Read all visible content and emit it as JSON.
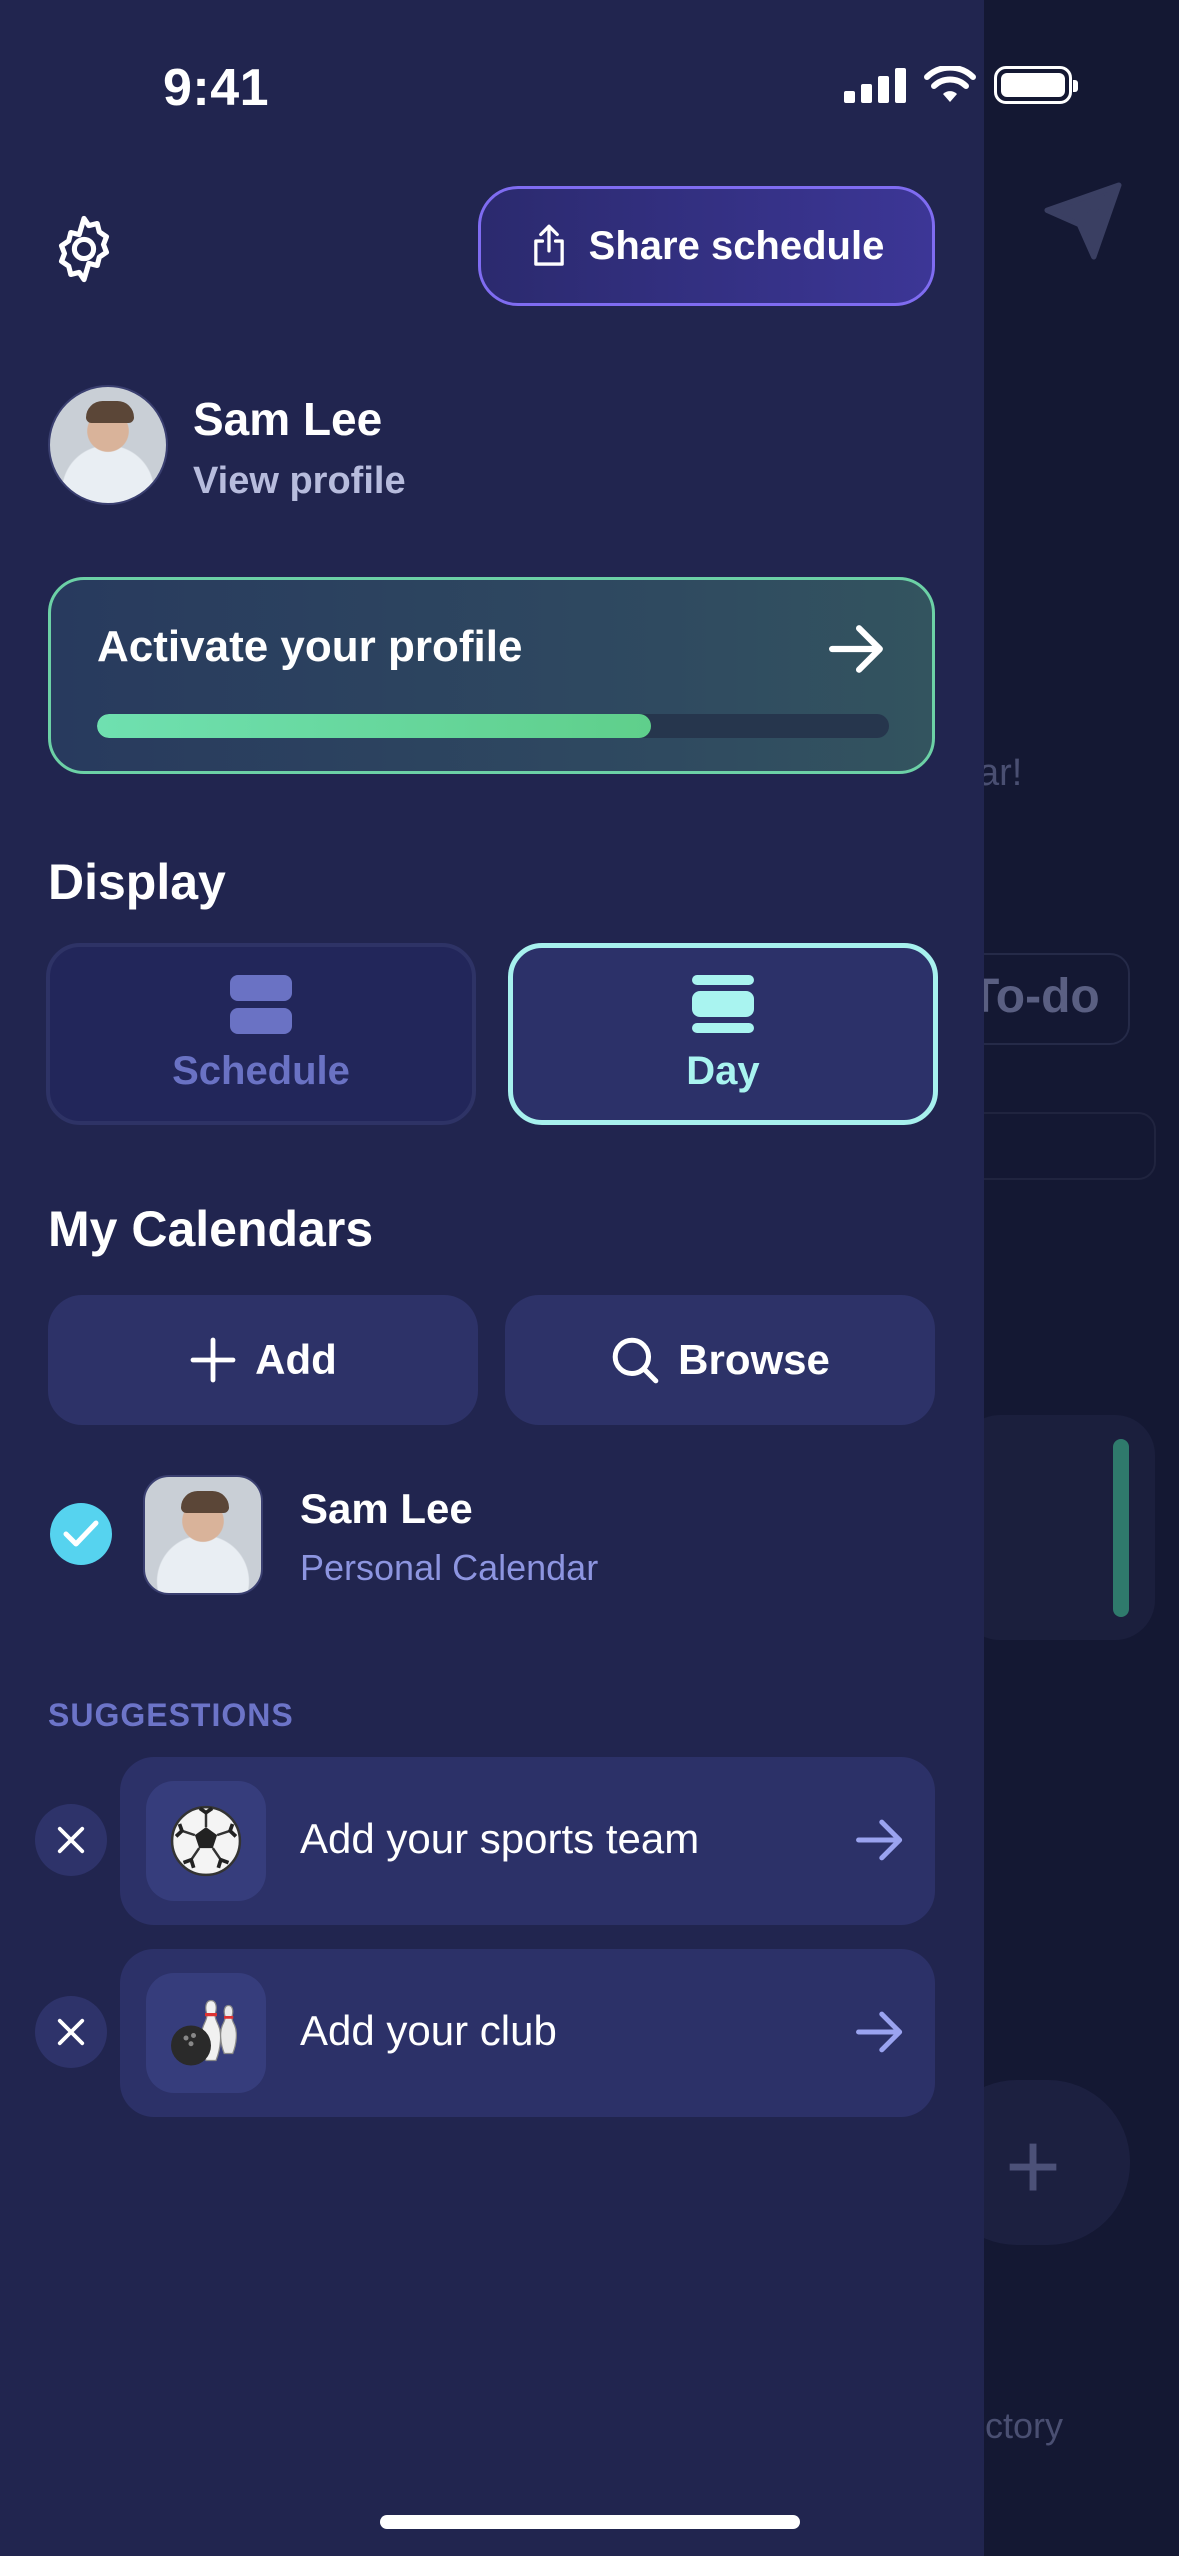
{
  "status_bar": {
    "time": "9:41"
  },
  "header": {
    "share_label": "Share schedule"
  },
  "profile": {
    "name": "Sam Lee",
    "link": "View profile"
  },
  "activate": {
    "title": "Activate your profile",
    "progress": 0.7
  },
  "display": {
    "title": "Display",
    "options": [
      {
        "label": "Schedule",
        "selected": false
      },
      {
        "label": "Day",
        "selected": true
      }
    ]
  },
  "calendars": {
    "title": "My Calendars",
    "add_label": "Add",
    "browse_label": "Browse",
    "items": [
      {
        "name": "Sam Lee",
        "subtitle": "Personal Calendar",
        "checked": true
      }
    ]
  },
  "suggestions": {
    "title": "SUGGESTIONS",
    "items": [
      {
        "label": "Add your sports team",
        "icon": "soccer-ball-icon"
      },
      {
        "label": "Add your club",
        "icon": "bowling-icon"
      }
    ]
  },
  "background": {
    "todo": "To-do",
    "ar_fragment": "ar!",
    "directory_fragment": "ctory"
  },
  "colors": {
    "drawer_bg": "#21254f",
    "accent_purple": "#7f6cf1",
    "accent_green": "#6cd1a6",
    "accent_cyan": "#a7f1ee",
    "check_blue": "#56d3ef"
  }
}
